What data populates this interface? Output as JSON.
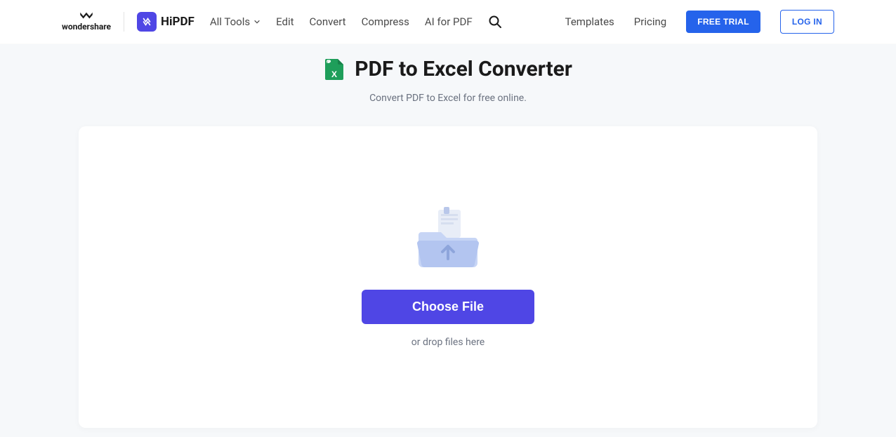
{
  "header": {
    "wondershare_label": "wondershare",
    "hipdf_label": "HiPDF",
    "nav": {
      "all_tools": "All Tools",
      "edit": "Edit",
      "convert": "Convert",
      "compress": "Compress",
      "ai_for_pdf": "AI for PDF"
    },
    "right": {
      "templates": "Templates",
      "pricing": "Pricing",
      "free_trial": "FREE TRIAL",
      "login": "LOG IN"
    }
  },
  "main": {
    "title": "PDF to Excel Converter",
    "subtitle": "Convert PDF to Excel for free online.",
    "choose_file": "Choose File",
    "drop_hint": "or drop files here"
  },
  "colors": {
    "primary_button": "#4f46e5",
    "header_button": "#2563eb",
    "excel_green": "#1e9e5a"
  }
}
